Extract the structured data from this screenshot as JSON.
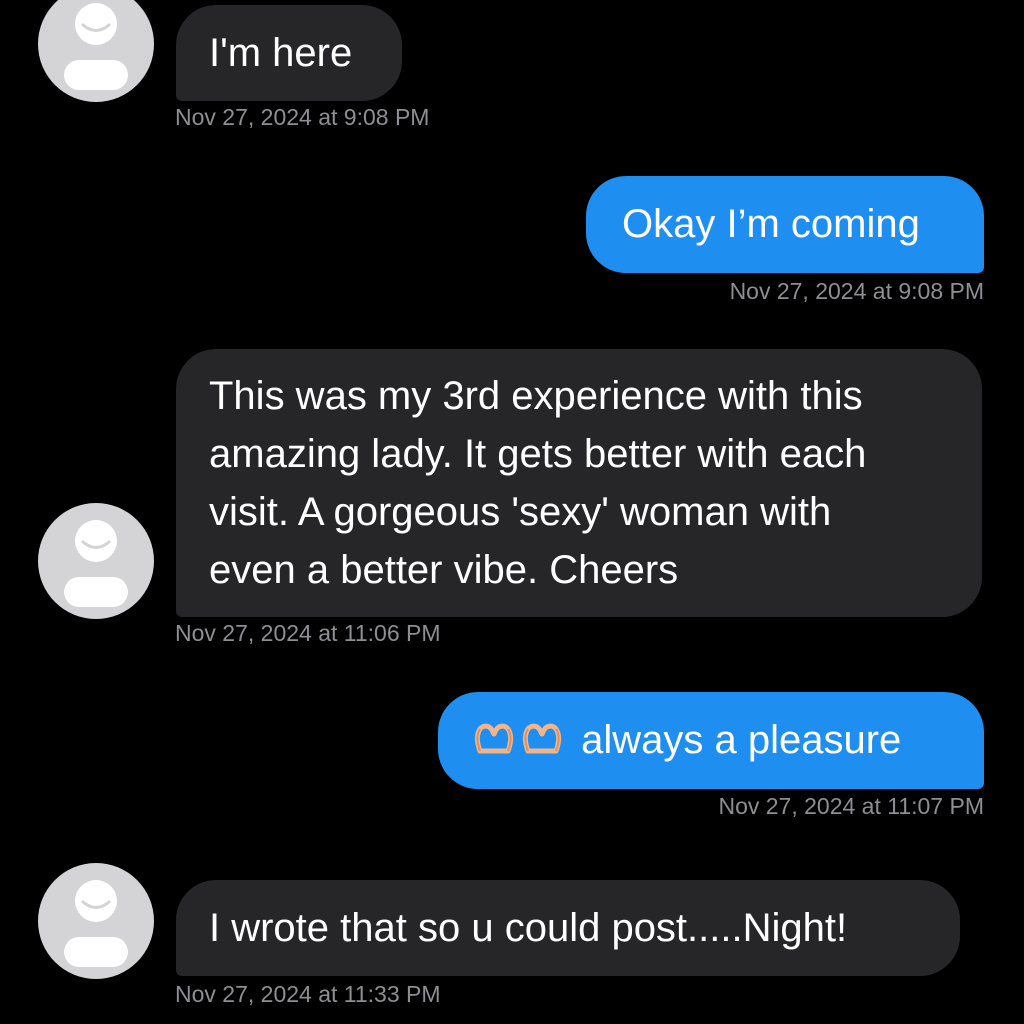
{
  "messages": [
    {
      "direction": "incoming",
      "text": "I'm here",
      "timestamp": "Nov 27, 2024 at 9:08 PM"
    },
    {
      "direction": "outgoing",
      "text": "Okay I’m coming",
      "timestamp": "Nov 27, 2024 at 9:08 PM"
    },
    {
      "direction": "incoming",
      "text_lines": [
        "This was my 3rd experience with this",
        "amazing lady. It gets better with each",
        "visit. A gorgeous 'sexy' woman with",
        "even a better vibe. Cheers"
      ],
      "timestamp": "Nov 27, 2024 at 11:06 PM"
    },
    {
      "direction": "outgoing",
      "emojis": [
        "heart-hands-emoji",
        "heart-hands-emoji"
      ],
      "text": "always a pleasure",
      "timestamp": "Nov 27, 2024 at 11:07 PM"
    },
    {
      "direction": "incoming",
      "text": "I wrote that so u could post.....Night!",
      "timestamp": "Nov 27, 2024 at 11:33 PM"
    }
  ],
  "colors": {
    "background": "#000000",
    "incoming_bubble": "#262628",
    "outgoing_bubble": "#1f8ef1",
    "timestamp": "#8e8e93",
    "avatar": "#d4d4d6"
  }
}
